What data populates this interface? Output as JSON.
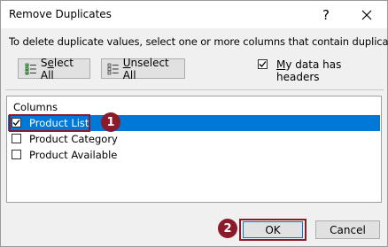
{
  "dialog": {
    "title": "Remove Duplicates",
    "help_glyph": "?",
    "instruction": "To delete duplicate values, select one or more columns that contain duplicates."
  },
  "toolbar": {
    "select_all_prefix": "S",
    "select_all_underlined": "e",
    "select_all_suffix": "lect All",
    "unselect_all_underlined": "U",
    "unselect_all_suffix": "nselect All"
  },
  "headers_option": {
    "checked": true,
    "label_underlined": "M",
    "label_rest": "y data has headers"
  },
  "columns": {
    "header": "Columns",
    "items": [
      {
        "label": "Product List",
        "checked": true,
        "selected": true
      },
      {
        "label": "Product Category",
        "checked": false,
        "selected": false
      },
      {
        "label": "Product Available",
        "checked": false,
        "selected": false
      }
    ]
  },
  "annotations": {
    "badge_1": "1",
    "badge_2": "2",
    "accent_color": "#8b1a2b"
  },
  "footer": {
    "ok_label": "OK",
    "cancel_label": "Cancel"
  }
}
